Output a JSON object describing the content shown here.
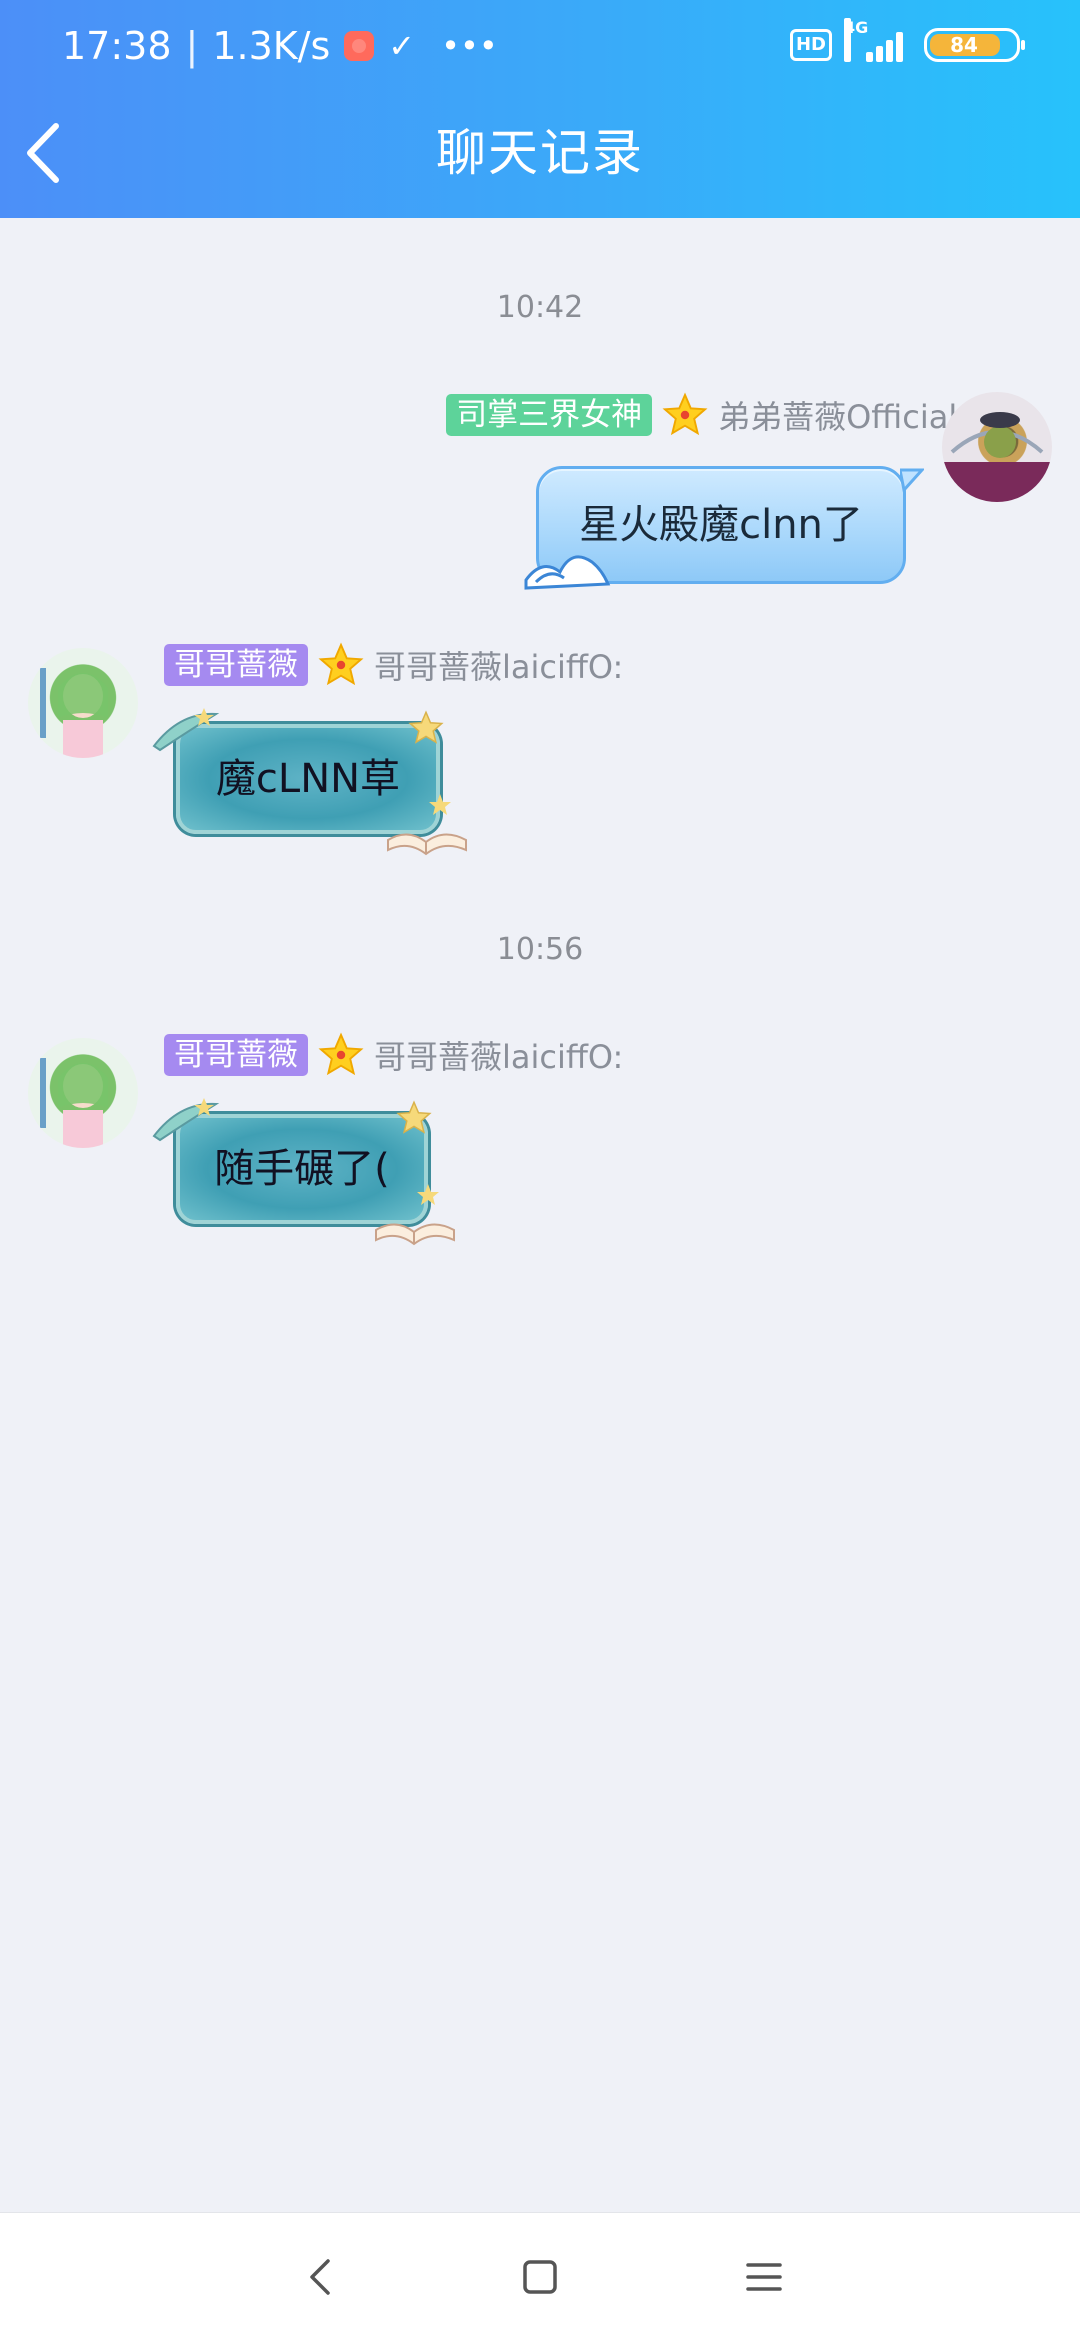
{
  "status_bar": {
    "time": "17:38",
    "speed": "1.3K/s",
    "network": "4G",
    "badge": "HD",
    "battery": "84",
    "battery_level": 0.84
  },
  "header": {
    "title": "聊天记录"
  },
  "colors": {
    "header_start": "#4c8ff8",
    "header_end": "#27c2fb",
    "background": "#eff1f7",
    "tag_green": "#5dd39a",
    "tag_purple": "#a58af0"
  },
  "messages": [
    {
      "time": "10:42",
      "tag": "司掌三界女神",
      "name": "弟弟蔷薇Official:",
      "text": "星火殿魔clnn了",
      "side": "right"
    },
    {
      "tag": "哥哥蔷薇",
      "name": "哥哥蔷薇laiciffO:",
      "text": "魔cLNN草",
      "side": "left"
    },
    {
      "time": "10:56",
      "tag": "哥哥蔷薇",
      "name": "哥哥蔷薇laiciffO:",
      "text": "随手碾了(",
      "side": "left"
    }
  ],
  "icons": {
    "back": "chevron-left-icon",
    "star": "star-icon",
    "nav_back": "nav-back-icon",
    "nav_home": "nav-home-icon",
    "nav_menu": "nav-menu-icon"
  }
}
